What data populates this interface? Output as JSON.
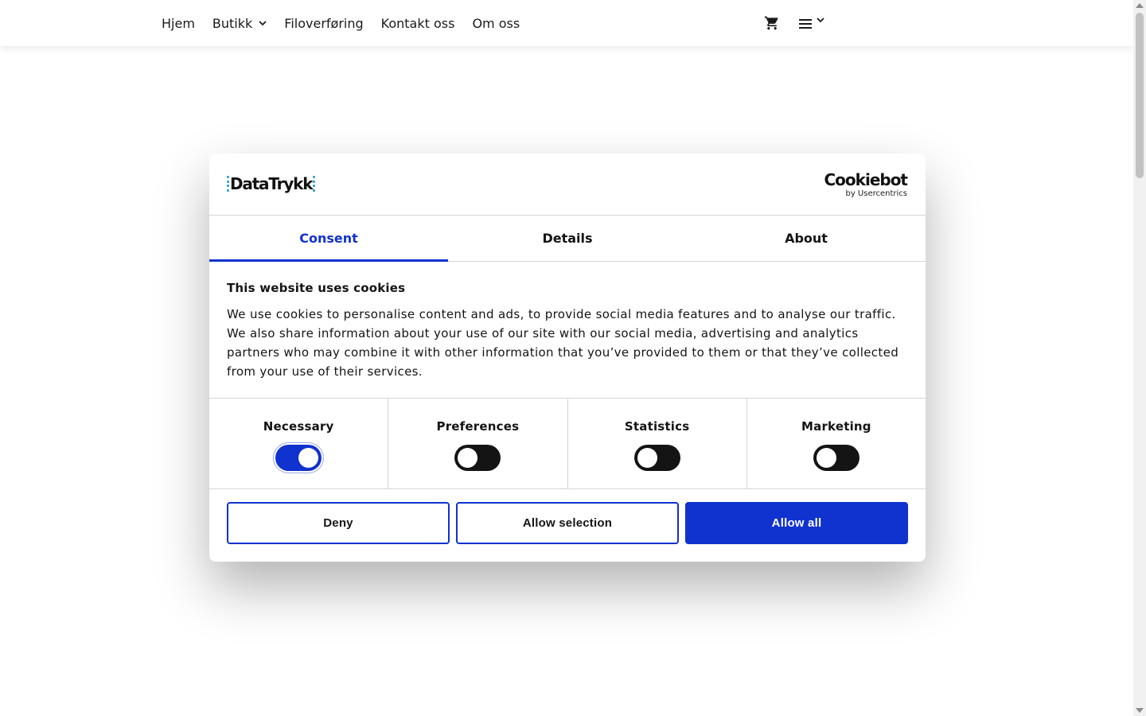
{
  "nav": {
    "items": [
      {
        "label": "Hjem",
        "has_dropdown": false
      },
      {
        "label": "Butikk",
        "has_dropdown": true
      },
      {
        "label": "Filoverføring",
        "has_dropdown": false
      },
      {
        "label": "Kontakt oss",
        "has_dropdown": false
      },
      {
        "label": "Om oss",
        "has_dropdown": false
      }
    ],
    "cart_icon": "cart-icon",
    "menu_icon": "hamburger-menu-icon"
  },
  "dialog": {
    "brand": "DataTrykk",
    "provider": {
      "name": "Cookiebot",
      "by": "by Usercentrics"
    },
    "tabs": [
      {
        "label": "Consent",
        "active": true
      },
      {
        "label": "Details",
        "active": false
      },
      {
        "label": "About",
        "active": false
      }
    ],
    "heading": "This website uses cookies",
    "text": "We use cookies to personalise content and ads, to provide social media features and to analyse our traffic. We also share information about your use of our site with our social media, advertising and analytics partners who may combine it with other information that you’ve provided to them or that they’ve collected from your use of their services.",
    "categories": [
      {
        "label": "Necessary",
        "enabled": true
      },
      {
        "label": "Preferences",
        "enabled": false
      },
      {
        "label": "Statistics",
        "enabled": false
      },
      {
        "label": "Marketing",
        "enabled": false
      }
    ],
    "buttons": {
      "deny": "Deny",
      "allow_selection": "Allow selection",
      "allow_all": "Allow all"
    }
  },
  "colors": {
    "accent": "#1032cf",
    "toggle_off": "#141414",
    "logo_dots": "#1a9ad6"
  }
}
